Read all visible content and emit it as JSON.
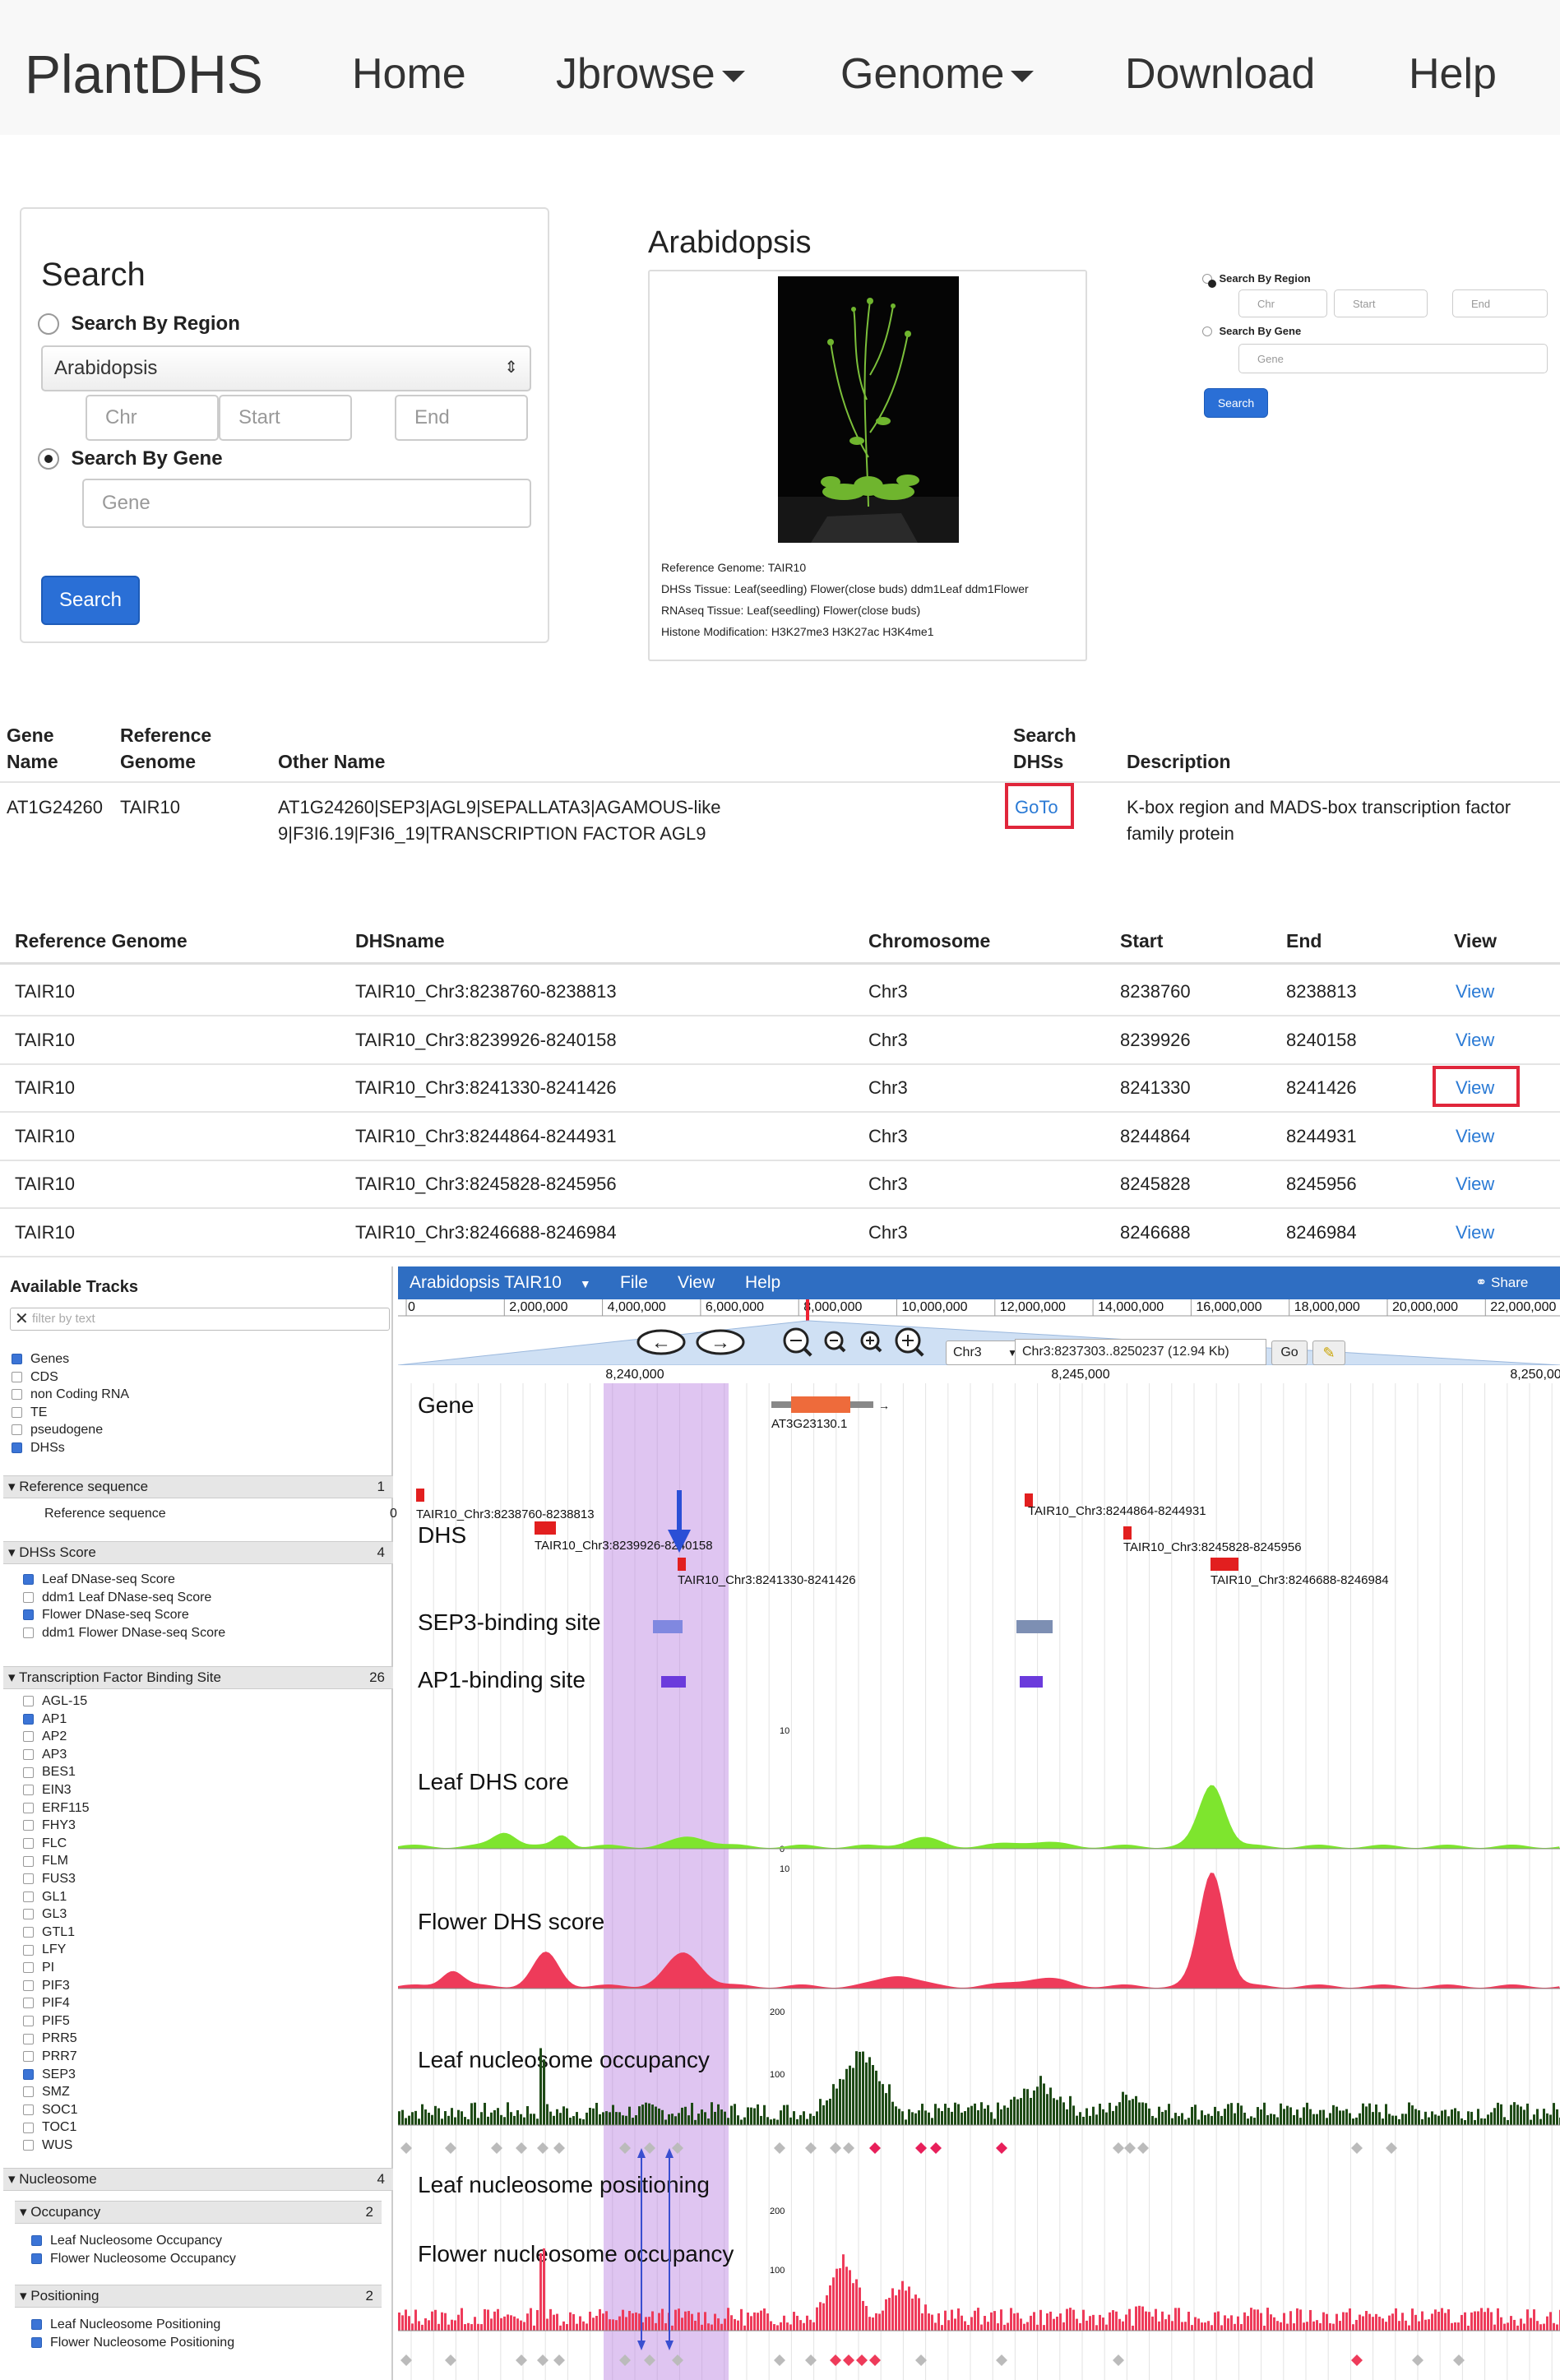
{
  "nav": {
    "brand": "PlantDHS",
    "items": [
      "Home",
      "Jbrowse",
      "Genome",
      "Download",
      "Help"
    ]
  },
  "search_panel": {
    "title": "Search",
    "by_region": "Search By Region",
    "species": "Arabidopsis",
    "chr_placeholder": "Chr",
    "start_placeholder": "Start",
    "end_placeholder": "End",
    "by_gene": "Search By Gene",
    "gene_placeholder": "Gene",
    "button": "Search"
  },
  "species_card": {
    "title": "Arabidopsis",
    "reference_genome": "Reference Genome: TAIR10",
    "dhs_tissue": "DHSs Tissue: Leaf(seedling) Flower(close buds) ddm1Leaf ddm1Flower",
    "rnaseq_tissue": "RNAseq Tissue: Leaf(seedling) Flower(close buds)",
    "histone": "Histone Modification: H3K27me3 H3K27ac H3K4me1"
  },
  "mini_search": {
    "by_region": "Search By Region",
    "chr": "Chr",
    "start": "Start",
    "end": "End",
    "by_gene": "Search By Gene",
    "gene": "Gene",
    "button": "Search"
  },
  "gene_table": {
    "headers": {
      "gene_name_1": "Gene",
      "gene_name_2": "Name",
      "ref_1": "Reference",
      "ref_2": "Genome",
      "other": "Other Name",
      "search_1": "Search",
      "search_2": "DHSs",
      "desc": "Description"
    },
    "row": {
      "gene": "AT1G24260",
      "genome": "TAIR10",
      "other_1": "AT1G24260|SEP3|AGL9|SEPALLATA3|AGAMOUS-like",
      "other_2": "9|F3I6.19|F3I6_19|TRANSCRIPTION FACTOR AGL9",
      "goto": "GoTo",
      "desc_1": "K-box region and MADS-box transcription factor",
      "desc_2": "family protein"
    }
  },
  "dhs_table": {
    "headers": [
      "Reference Genome",
      "DHSname",
      "Chromosome",
      "Start",
      "End",
      "View"
    ],
    "rows": [
      [
        "TAIR10",
        "TAIR10_Chr3:8238760-8238813",
        "Chr3",
        "8238760",
        "8238813",
        "View"
      ],
      [
        "TAIR10",
        "TAIR10_Chr3:8239926-8240158",
        "Chr3",
        "8239926",
        "8240158",
        "View"
      ],
      [
        "TAIR10",
        "TAIR10_Chr3:8241330-8241426",
        "Chr3",
        "8241330",
        "8241426",
        "View"
      ],
      [
        "TAIR10",
        "TAIR10_Chr3:8244864-8244931",
        "Chr3",
        "8244864",
        "8244931",
        "View"
      ],
      [
        "TAIR10",
        "TAIR10_Chr3:8245828-8245956",
        "Chr3",
        "8245828",
        "8245956",
        "View"
      ],
      [
        "TAIR10",
        "TAIR10_Chr3:8246688-8246984",
        "Chr3",
        "8246688",
        "8246984",
        "View"
      ]
    ]
  },
  "sidebar": {
    "title": "Available Tracks",
    "filter_placeholder": "filter by text",
    "top_items": [
      {
        "label": "Genes",
        "checked": true
      },
      {
        "label": "CDS",
        "checked": false
      },
      {
        "label": "non Coding RNA",
        "checked": false
      },
      {
        "label": "TE",
        "checked": false
      },
      {
        "label": "pseudogene",
        "checked": false
      },
      {
        "label": "DHSs",
        "checked": true
      }
    ],
    "cat_refseq": {
      "label": "Reference sequence",
      "count": "1"
    },
    "refseq_item": {
      "label": "Reference sequence",
      "count": "0"
    },
    "cat_dhs": {
      "label": "DHSs Score",
      "count": "4"
    },
    "dhs_items": [
      {
        "label": "Leaf DNase-seq Score",
        "checked": true
      },
      {
        "label": "ddm1 Leaf DNase-seq Score",
        "checked": false
      },
      {
        "label": "Flower DNase-seq Score",
        "checked": true
      },
      {
        "label": "ddm1 Flower DNase-seq Score",
        "checked": false
      }
    ],
    "cat_tfbs": {
      "label": "Transcription Factor Binding Site",
      "count": "26"
    },
    "tf_items": [
      {
        "label": "AGL-15",
        "checked": false
      },
      {
        "label": "AP1",
        "checked": true
      },
      {
        "label": "AP2",
        "checked": false
      },
      {
        "label": "AP3",
        "checked": false
      },
      {
        "label": "BES1",
        "checked": false
      },
      {
        "label": "EIN3",
        "checked": false
      },
      {
        "label": "ERF115",
        "checked": false
      },
      {
        "label": "FHY3",
        "checked": false
      },
      {
        "label": "FLC",
        "checked": false
      },
      {
        "label": "FLM",
        "checked": false
      },
      {
        "label": "FUS3",
        "checked": false
      },
      {
        "label": "GL1",
        "checked": false
      },
      {
        "label": "GL3",
        "checked": false
      },
      {
        "label": "GTL1",
        "checked": false
      },
      {
        "label": "LFY",
        "checked": false
      },
      {
        "label": "PI",
        "checked": false
      },
      {
        "label": "PIF3",
        "checked": false
      },
      {
        "label": "PIF4",
        "checked": false
      },
      {
        "label": "PIF5",
        "checked": false
      },
      {
        "label": "PRR5",
        "checked": false
      },
      {
        "label": "PRR7",
        "checked": false
      },
      {
        "label": "SEP3",
        "checked": true
      },
      {
        "label": "SMZ",
        "checked": false
      },
      {
        "label": "SOC1",
        "checked": false
      },
      {
        "label": "TOC1",
        "checked": false
      },
      {
        "label": "WUS",
        "checked": false
      }
    ],
    "cat_nuc": {
      "label": "Nucleosome",
      "count": "4"
    },
    "sub_occ": {
      "label": "Occupancy",
      "count": "2"
    },
    "occ_items": [
      {
        "label": "Leaf Nucleosome Occupancy",
        "checked": true
      },
      {
        "label": "Flower Nucleosome Occupancy",
        "checked": true
      }
    ],
    "sub_pos": {
      "label": "Positioning",
      "count": "2"
    },
    "pos_items": [
      {
        "label": "Leaf Nucleosome Positioning",
        "checked": true
      },
      {
        "label": "Flower Nucleosome Positioning",
        "checked": true
      }
    ]
  },
  "jbrowse": {
    "dataset": "Arabidopsis TAIR10",
    "menus": [
      "File",
      "View",
      "Help"
    ],
    "share": "Share",
    "overview_ticks": [
      "0",
      "2,000,000",
      "4,000,000",
      "6,000,000",
      "8,000,000",
      "10,000,000",
      "12,000,000",
      "14,000,000",
      "16,000,000",
      "18,000,000",
      "20,000,000",
      "22,000,000"
    ],
    "chrom": "Chr3",
    "location": "Chr3:8237303..8250237 (12.94 Kb)",
    "go": "Go",
    "detail_ticks": [
      "8,240,000",
      "8,245,000",
      "8,250,000"
    ],
    "tracks": {
      "gene": "Gene",
      "gene_feature": "AT3G23130.1",
      "dhs": "DHS",
      "dhs_features": [
        "TAIR10_Chr3:8238760-8238813",
        "TAIR10_Chr3:8239926-8240158",
        "TAIR10_Chr3:8241330-8241426",
        "TAIR10_Chr3:8244864-8244931",
        "TAIR10_Chr3:8245828-8245956",
        "TAIR10_Chr3:8246688-8246984"
      ],
      "sep3": "SEP3-binding site",
      "ap1": "AP1-binding site",
      "leaf_dhs": "Leaf DHS core",
      "flower_dhs": "Flower DHS score",
      "leaf_occ": "Leaf nucleosome occupancy",
      "leaf_pos": "Leaf nucleosome positioning",
      "flower_occ": "Flower nucleosome occupancy",
      "flower_pos": "Flower nucleosome positioning",
      "axis_10": "10",
      "axis_0": "0",
      "axis_200": "200",
      "axis_100": "100"
    },
    "colors": {
      "leaf": "#7ee52e",
      "flower": "#ee3b5a",
      "nuc_leaf": "#1e4a16",
      "highlight": "#b77ee0",
      "menubar": "#2f6ec2"
    }
  }
}
